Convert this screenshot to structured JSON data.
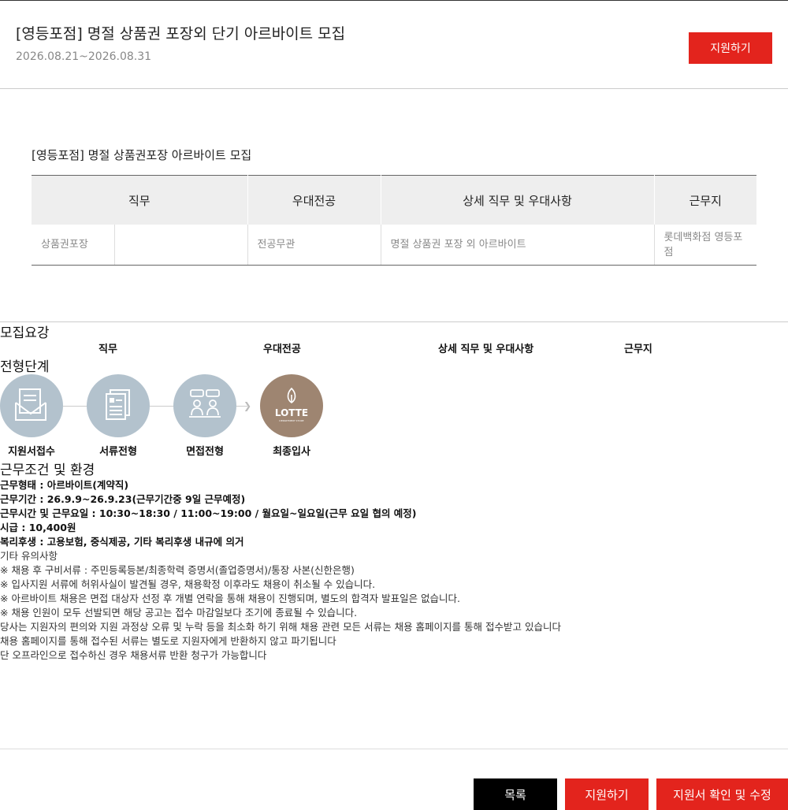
{
  "header": {
    "title": "[영등포점] 명절 상품권 포장외 단기 아르바이트 모집",
    "date_range": "2026.08.21~2026.08.31",
    "apply_label": "지원하기"
  },
  "section": {
    "title": "[영등포점] 명절 상품권포장 아르바이트 모집"
  },
  "table": {
    "headers": [
      "직무",
      "우대전공",
      "상세 직무 및 우대사항",
      "근무지"
    ],
    "row": {
      "job": "상품권포장",
      "job_sub": "",
      "major": "전공무관",
      "detail": "명절 상품권 포장 외 아르바이트",
      "location": "롯데백화점 영등포점"
    }
  },
  "recruit": {
    "title": "모집요강",
    "col_headers": [
      "직무",
      "우대전공",
      "상세 직무 및 우대사항",
      "근무지"
    ]
  },
  "process": {
    "title": "전형단계",
    "steps": [
      "지원서접수",
      "서류전형",
      "면접전형",
      "최종입사"
    ],
    "logo_text": "LOTTE",
    "logo_sub": "DEPARTMENT STORE"
  },
  "conditions": {
    "title": "근무조건 및 환경",
    "lines": [
      "근무형태 : 아르바이트(계약직)",
      "근무기간 : 26.9.9~26.9.23(근무기간중 9일 근무예정)",
      "근무시간 및 근무요일 : 10:30~18:30 / 11:00~19:00 / 월요일~일요일(근무 요일 협의 예정)",
      "시급 : 10,400원",
      "복리후생 : 고용보험, 중식제공, 기타 복리후생 내규에 의거"
    ]
  },
  "notes": {
    "title": "기타 유의사항",
    "lines": [
      "※ 채용 후 구비서류 : 주민등록등본/최종학력 증명서(졸업증명서)/통장 사본(신한은행)",
      "※ 입사지원 서류에 허위사실이 발견될 경우, 채용확정 이후라도 채용이 취소될 수 있습니다.",
      "※ 아르바이트 채용은 면접 대상자 선정 후 개별 연락을 통해 채용이 진행되며, 별도의 합격자 발표일은 없습니다.",
      "※ 채용 인원이 모두 선발되면 해당 공고는 접수 마감일보다 조기에 종료될 수 있습니다.",
      "당사는 지원자의 편의와 지원 과정상 오류 및 누락 등을 최소화 하기 위해 채용 관련 모든 서류는 채용 홈페이지를 통해 접수받고 있습니다",
      "채용 홈페이지를 통해 접수된 서류는 별도로 지원자에게 반환하지 않고 파기됩니다",
      "단 오프라인으로 접수하신 경우 채용서류 반환 청구가 가능합니다"
    ]
  },
  "footer": {
    "list_label": "목록",
    "apply_label": "지원하기",
    "check_label": "지원서 확인 및 수정"
  },
  "colors": {
    "accent": "#e3241d",
    "step_circle": "#b3c2cd",
    "lotte_circle": "#9e8571"
  }
}
